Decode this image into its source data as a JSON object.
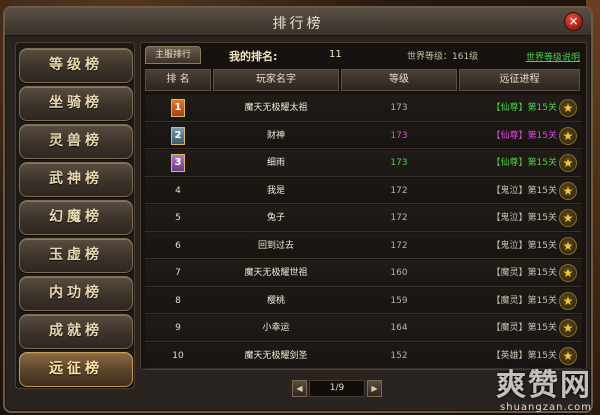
{
  "window": {
    "title": "排行榜",
    "close_label": "×"
  },
  "sidebar": {
    "items": [
      {
        "label": "等级榜"
      },
      {
        "label": "坐骑榜"
      },
      {
        "label": "灵兽榜"
      },
      {
        "label": "武神榜"
      },
      {
        "label": "幻魔榜"
      },
      {
        "label": "玉虚榜"
      },
      {
        "label": "内功榜"
      },
      {
        "label": "成就榜"
      },
      {
        "label": "远征榜",
        "active": true
      }
    ]
  },
  "panel": {
    "tab_label": "主服排行",
    "my_rank_label": "我的排名:",
    "my_rank_value": "11",
    "world_level": "世界等级：161级",
    "world_level_link": "世界等级说明",
    "headers": [
      "排 名",
      "玩家名字",
      "等级",
      "远征进程"
    ]
  },
  "rows": [
    {
      "rank": "1",
      "name": "魔天无极耀太祖",
      "level": "173",
      "realm": "【仙尊】",
      "stage": "第15关",
      "realm_color": "#4cd24c",
      "level_color": "#b8b0a0"
    },
    {
      "rank": "2",
      "name": "财神",
      "level": "173",
      "realm": "【仙尊】",
      "stage": "第15关",
      "realm_color": "#e04ae0",
      "level_color": "#e04ae0"
    },
    {
      "rank": "3",
      "name": "细雨",
      "level": "173",
      "realm": "【仙尊】",
      "stage": "第15关",
      "realm_color": "#4cd24c",
      "level_color": "#4cd24c"
    },
    {
      "rank": "4",
      "name": "我是",
      "level": "172",
      "realm": "【鬼泣】",
      "stage": "第15关",
      "realm_color": "#c8c0b0",
      "level_color": "#b8b0a0"
    },
    {
      "rank": "5",
      "name": "兔子",
      "level": "172",
      "realm": "【鬼泣】",
      "stage": "第15关",
      "realm_color": "#c8c0b0",
      "level_color": "#b8b0a0"
    },
    {
      "rank": "6",
      "name": "回到过去",
      "level": "172",
      "realm": "【鬼泣】",
      "stage": "第15关",
      "realm_color": "#c8c0b0",
      "level_color": "#b8b0a0"
    },
    {
      "rank": "7",
      "name": "魔天无极耀世祖",
      "level": "160",
      "realm": "【魔灵】",
      "stage": "第15关",
      "realm_color": "#c8c0b0",
      "level_color": "#b8b0a0"
    },
    {
      "rank": "8",
      "name": "樱桃",
      "level": "159",
      "realm": "【魔灵】",
      "stage": "第15关",
      "realm_color": "#c8c0b0",
      "level_color": "#b8b0a0"
    },
    {
      "rank": "9",
      "name": "小幸运",
      "level": "164",
      "realm": "【魔灵】",
      "stage": "第15关",
      "realm_color": "#c8c0b0",
      "level_color": "#b8b0a0"
    },
    {
      "rank": "10",
      "name": "魔天无极耀剑圣",
      "level": "152",
      "realm": "【英雄】",
      "stage": "第15关",
      "realm_color": "#c8c0b0",
      "level_color": "#b8b0a0"
    }
  ],
  "pager": {
    "prev": "◀",
    "next": "▶",
    "text": "1/9"
  },
  "watermark": {
    "cn": "爽赞网",
    "url": "shuangzan.com"
  },
  "icons": {
    "star": "★"
  }
}
